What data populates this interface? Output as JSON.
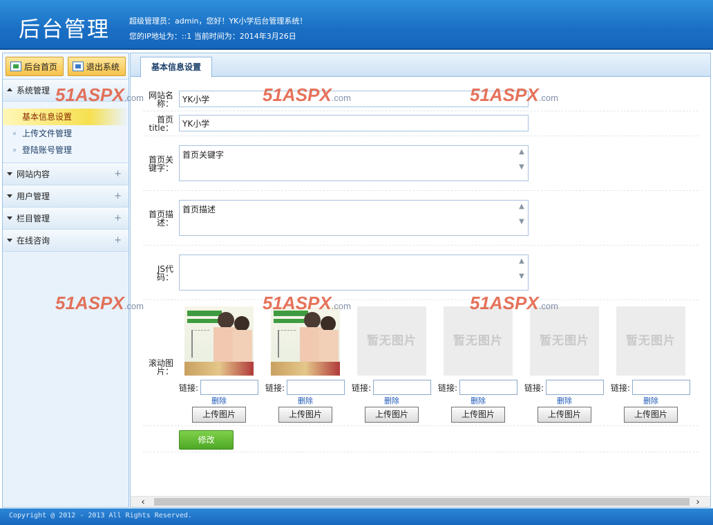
{
  "header": {
    "title": "后台管理",
    "welcome_line1": "超级管理员：admin，您好！YK小学后台管理系统！",
    "welcome_line2": "您的IP地址为：::1 当前时间为：2014年3月26日"
  },
  "sidebar": {
    "home_label": "后台首页",
    "logout_label": "退出系统",
    "menus": [
      {
        "label": "系统管理",
        "expanded": true,
        "items": [
          "基本信息设置",
          "上传文件管理",
          "登陆账号管理"
        ]
      },
      {
        "label": "网站内容",
        "expanded": false
      },
      {
        "label": "用户管理",
        "expanded": false
      },
      {
        "label": "栏目管理",
        "expanded": false
      },
      {
        "label": "在线咨询",
        "expanded": false
      }
    ],
    "active_item": "基本信息设置"
  },
  "main": {
    "tab_label": "基本信息设置",
    "fields": {
      "site_name_label": "网站名称：",
      "site_name_value": "YK小学",
      "home_title_label": "首页title：",
      "home_title_value": "YK小学",
      "keywords_label": "首页关键字：",
      "keywords_value": "首页关键字",
      "description_label": "首页描述：",
      "description_value": "首页描述",
      "js_label": "JS代码：",
      "js_value": ""
    },
    "slider": {
      "label": "滚动图片：",
      "link_label": "链接:",
      "delete_label": "删除",
      "upload_label": "上传图片",
      "no_image_text": "暂无图片",
      "images": [
        {
          "has_image": true
        },
        {
          "has_image": true
        },
        {
          "has_image": false
        },
        {
          "has_image": false
        },
        {
          "has_image": false
        },
        {
          "has_image": false
        }
      ]
    },
    "submit_label": "修改"
  },
  "footer": {
    "copyright": "Copyright @ 2012 - 2013 All Rights Reserved."
  },
  "watermark": {
    "main": "51ASPX",
    "suffix": ".com"
  },
  "colors": {
    "header": "#1a6fc4",
    "accent_yellow": "#f7c24a",
    "submit_green": "#4ea826",
    "link_blue": "#1e58b8"
  }
}
